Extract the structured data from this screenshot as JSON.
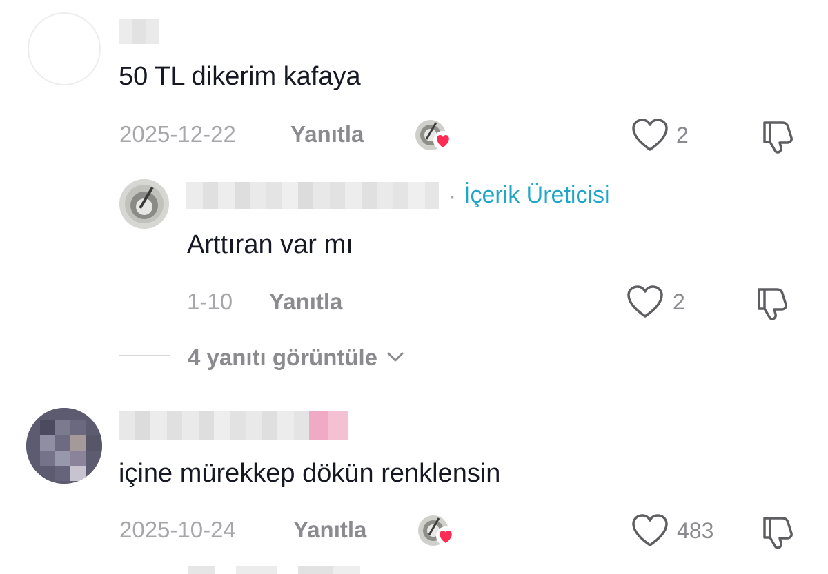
{
  "comments": [
    {
      "text": "50 TL dikerim kafaya",
      "date": "2025-12-22",
      "reply_label": "Yanıtla",
      "likes": "2",
      "creator_liked": true,
      "replies": [
        {
          "creator_tag": "İçerik Üreticisi",
          "separator": "·",
          "text": "Arttıran var mı",
          "date": "1-10",
          "reply_label": "Yanıtla",
          "likes": "2"
        }
      ],
      "view_replies_label": "4 yanıtı görüntüle"
    },
    {
      "text": "içine mürekkep dökün renklensin",
      "date": "2025-10-24",
      "reply_label": "Yanıtla",
      "likes": "483",
      "creator_liked": true
    }
  ],
  "icons": {
    "like": "heart-outline-icon",
    "dislike": "thumbs-down-icon",
    "creator_like": "creator-heart-badge-icon",
    "expand": "chevron-down-icon"
  },
  "colors": {
    "text_primary": "#161823",
    "text_secondary": "#8b8b8f",
    "date": "#a7a7ab",
    "creator_tag": "#20a7c8",
    "heart_badge": "#fe2c55"
  }
}
